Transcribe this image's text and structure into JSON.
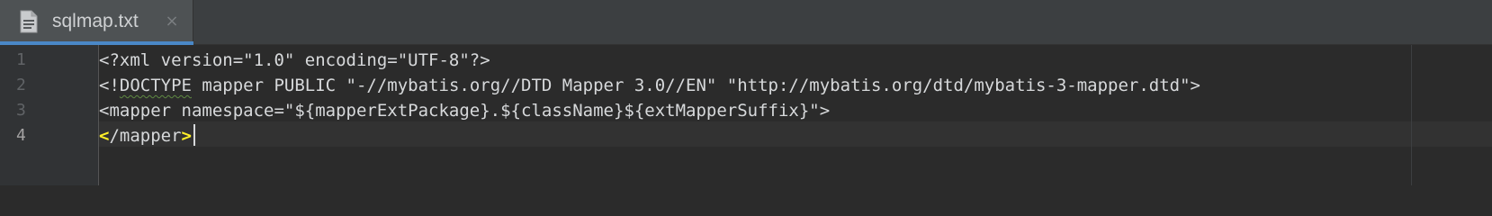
{
  "tab": {
    "file_icon": "text-file-icon",
    "filename": "sqlmap.txt",
    "close_icon": "close-icon",
    "close_glyph": "×"
  },
  "gutter": {
    "line_numbers": [
      "1",
      "2",
      "3",
      "4"
    ]
  },
  "code": {
    "lines": [
      {
        "text": "<?xml version=\"1.0\" encoding=\"UTF-8\"?>"
      },
      {
        "prefix": "<!",
        "squiggle": "DOCTYPE",
        "suffix": " mapper PUBLIC \"-//mybatis.org//DTD Mapper 3.0//EN\" \"http://mybatis.org/dtd/mybatis-3-mapper.dtd\">"
      },
      {
        "text": "<mapper namespace=\"${mapperExtPackage}.${className}${extMapperSuffix}\">"
      },
      {
        "open_bracket": "<",
        "middle": "/mapper",
        "close_bracket": ">"
      }
    ]
  },
  "colors": {
    "background": "#2b2b2b",
    "tab_active_underline": "#4a88c7",
    "text": "#d7d9db",
    "bracket_highlight": "#ffef28",
    "typo_squiggle": "#5f8a42"
  }
}
